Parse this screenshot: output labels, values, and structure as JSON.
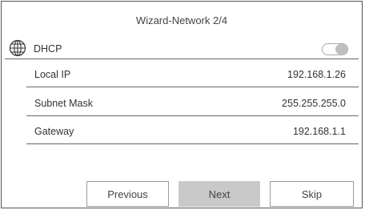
{
  "dialog": {
    "title": "Wizard-Network 2/4"
  },
  "dhcp": {
    "label": "DHCP",
    "enabled": false,
    "icon": "globe-icon"
  },
  "fields": [
    {
      "label": "Local IP",
      "value": "192.168.1.26"
    },
    {
      "label": "Subnet Mask",
      "value": "255.255.255.0"
    },
    {
      "label": "Gateway",
      "value": "192.168.1.1"
    }
  ],
  "buttons": {
    "previous": "Previous",
    "next": "Next",
    "skip": "Skip"
  },
  "colors": {
    "primary_button_bg": "#c9c9c9",
    "divider": "#666666",
    "toggle_knob": "#bfbfbf"
  }
}
